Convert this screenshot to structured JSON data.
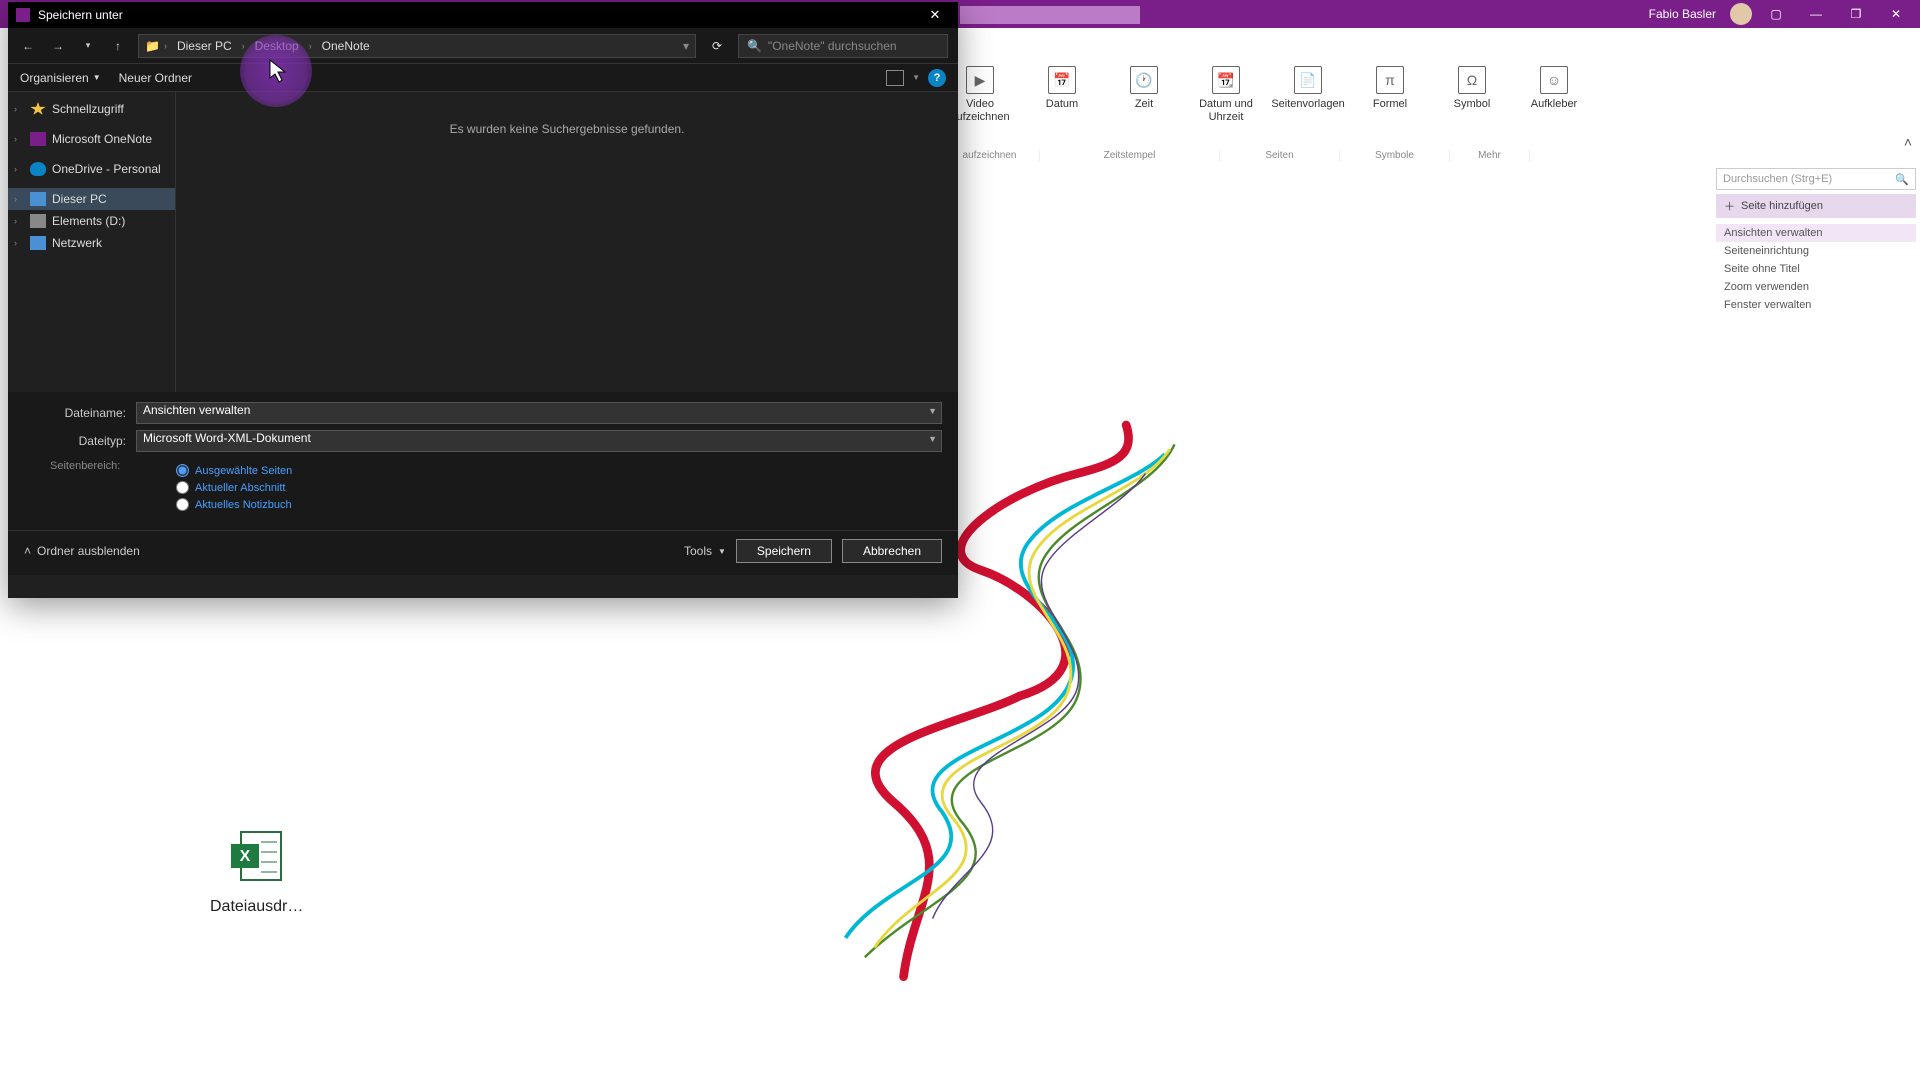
{
  "app": {
    "user_name": "Fabio Basler"
  },
  "ribbon": {
    "items": [
      {
        "label": "Video\naufzeichnen",
        "icon": "▶"
      },
      {
        "label": "Datum",
        "icon": "📅"
      },
      {
        "label": "Zeit",
        "icon": "🕐"
      },
      {
        "label": "Datum und\nUhrzeit",
        "icon": "📆"
      },
      {
        "label": "Seitenvorlagen",
        "icon": "📄"
      },
      {
        "label": "Formel",
        "icon": "π"
      },
      {
        "label": "Symbol",
        "icon": "Ω"
      },
      {
        "label": "Aufkleber",
        "icon": "☺"
      }
    ],
    "groups": [
      "aufzeichnen",
      "Zeitstempel",
      "Seiten",
      "Symbole",
      "Mehr"
    ]
  },
  "right_panel": {
    "search_placeholder": "Durchsuchen (Strg+E)",
    "add_page": "Seite hinzufügen",
    "pages": [
      "Ansichten verwalten",
      "Seiteneinrichtung",
      "Seite ohne Titel",
      "Zoom verwenden",
      "Fenster verwalten"
    ]
  },
  "canvas": {
    "file_label": "Dateiausdr…"
  },
  "dialog": {
    "title": "Speichern unter",
    "breadcrumb": [
      "Dieser PC",
      "Desktop",
      "OneNote"
    ],
    "search_placeholder": "\"OneNote\" durchsuchen",
    "toolbar": {
      "organize": "Organisieren",
      "new_folder": "Neuer Ordner"
    },
    "tree": [
      {
        "label": "Schnellzugriff",
        "icon": "ti-star"
      },
      {
        "label": "Microsoft OneNote",
        "icon": "ti-onenote"
      },
      {
        "label": "OneDrive - Personal",
        "icon": "ti-cloud"
      },
      {
        "label": "Dieser PC",
        "icon": "ti-pc",
        "selected": true
      },
      {
        "label": "Elements (D:)",
        "icon": "ti-drive"
      },
      {
        "label": "Netzwerk",
        "icon": "ti-net"
      }
    ],
    "empty_msg": "Es wurden keine Suchergebnisse gefunden.",
    "filename_label": "Dateiname:",
    "filename_value": "Ansichten verwalten",
    "filetype_label": "Dateityp:",
    "filetype_value": "Microsoft Word-XML-Dokument",
    "range_label": "Seitenbereich:",
    "range_options": [
      "Ausgewählte Seiten",
      "Aktueller Abschnitt",
      "Aktuelles Notizbuch"
    ],
    "hide_folders": "Ordner ausblenden",
    "tools": "Tools",
    "save": "Speichern",
    "cancel": "Abbrechen"
  }
}
